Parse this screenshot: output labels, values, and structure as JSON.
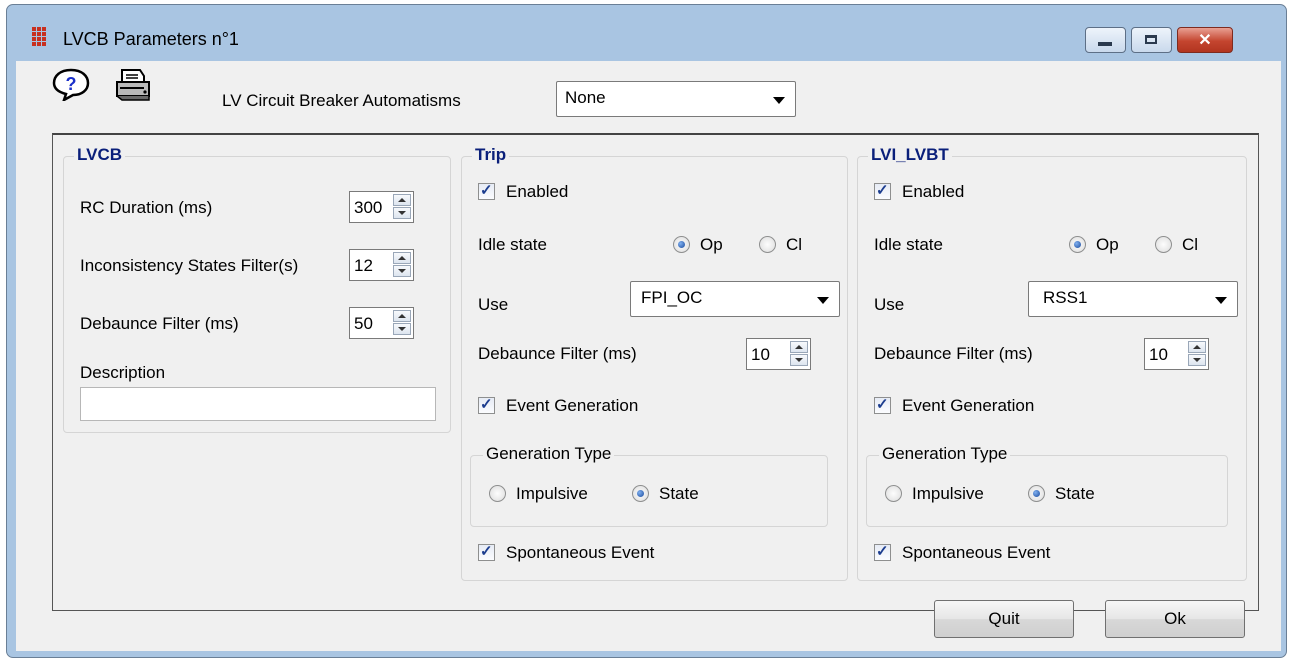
{
  "window": {
    "title": "LVCB Parameters n°1",
    "close_glyph": "✕"
  },
  "toolbar": {
    "help_icon": "help-question-icon",
    "print_icon": "printer-icon",
    "automatisms_label": "LV Circuit Breaker Automatisms",
    "automatisms_value": "None"
  },
  "lvcb": {
    "title": "LVCB",
    "rc_duration_label": "RC Duration (ms)",
    "rc_duration_value": "300",
    "inconsistency_label": "Inconsistency States Filter(s)",
    "inconsistency_value": "12",
    "debounce_label": "Debaunce Filter (ms)",
    "debounce_value": "50",
    "description_label": "Description",
    "description_value": ""
  },
  "trip": {
    "title": "Trip",
    "enabled_label": "Enabled",
    "enabled": true,
    "idle_state_label": "Idle state",
    "op_label": "Op",
    "cl_label": "Cl",
    "idle_state": "Op",
    "use_label": "Use",
    "use_value": "FPI_OC",
    "debounce_label": "Debaunce Filter (ms)",
    "debounce_value": "10",
    "event_generation_label": "Event Generation",
    "event_generation": true,
    "generation_type_label": "Generation Type",
    "impulsive_label": "Impulsive",
    "state_label": "State",
    "generation_type": "State",
    "spontaneous_label": "Spontaneous Event",
    "spontaneous": true
  },
  "lvi": {
    "title": "LVI_LVBT",
    "enabled_label": "Enabled",
    "enabled": true,
    "idle_state_label": "Idle state",
    "op_label": "Op",
    "cl_label": "Cl",
    "idle_state": "Op",
    "use_label": "Use",
    "use_value": "RSS1",
    "debounce_label": "Debaunce Filter (ms)",
    "debounce_value": "10",
    "event_generation_label": "Event Generation",
    "event_generation": true,
    "generation_type_label": "Generation Type",
    "impulsive_label": "Impulsive",
    "state_label": "State",
    "generation_type": "State",
    "spontaneous_label": "Spontaneous Event",
    "spontaneous": true
  },
  "footer": {
    "quit_label": "Quit",
    "ok_label": "Ok"
  },
  "colors": {
    "frame": "#a9c5e2",
    "client": "#f0f0f0",
    "group_title": "#0a1f7a",
    "close_button": "#c4452f"
  }
}
